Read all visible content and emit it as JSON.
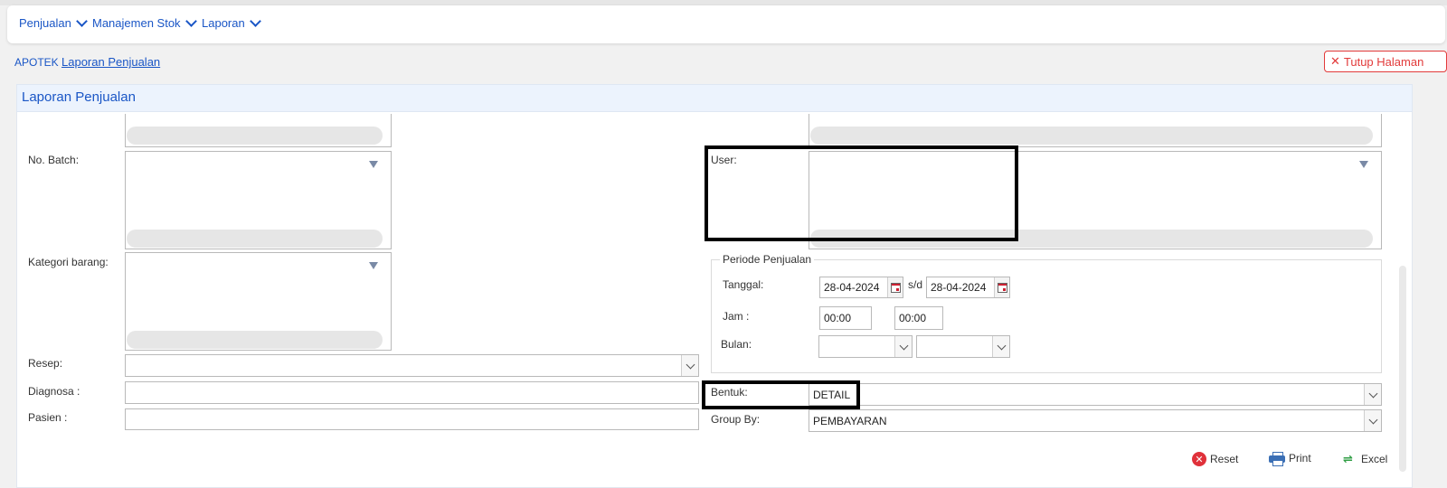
{
  "nav": {
    "items": [
      {
        "label": "Penjualan"
      },
      {
        "label": "Manajemen Stok"
      },
      {
        "label": "Laporan"
      }
    ]
  },
  "breadcrumb": {
    "root": "APOTEK",
    "current": "Laporan Penjualan"
  },
  "close_button": {
    "label": "Tutup Halaman"
  },
  "panel": {
    "title": "Laporan Penjualan"
  },
  "form": {
    "no_batch_label": "No. Batch:",
    "kategori_label": "Kategori barang:",
    "resep_label": "Resep:",
    "diagnosa_label": "Diagnosa :",
    "pasien_label": "Pasien :",
    "user_label": "User:",
    "periode": {
      "legend": "Periode Penjualan",
      "tanggal_label": "Tanggal:",
      "tanggal_from": "28-04-2024",
      "sd_label": "s/d",
      "tanggal_to": "28-04-2024",
      "jam_label": "Jam :",
      "jam_from": "00:00",
      "jam_to": "00:00",
      "bulan_label": "Bulan:"
    },
    "bentuk_label": "Bentuk:",
    "bentuk_value": "DETAIL",
    "groupby_label": "Group By:",
    "groupby_value": "PEMBAYARAN"
  },
  "actions": {
    "reset": "Reset",
    "print": "Print",
    "excel": "Excel"
  },
  "colors": {
    "accent": "#1a56c6",
    "danger": "#e23a3a",
    "panel_header": "#ecf3fd"
  }
}
